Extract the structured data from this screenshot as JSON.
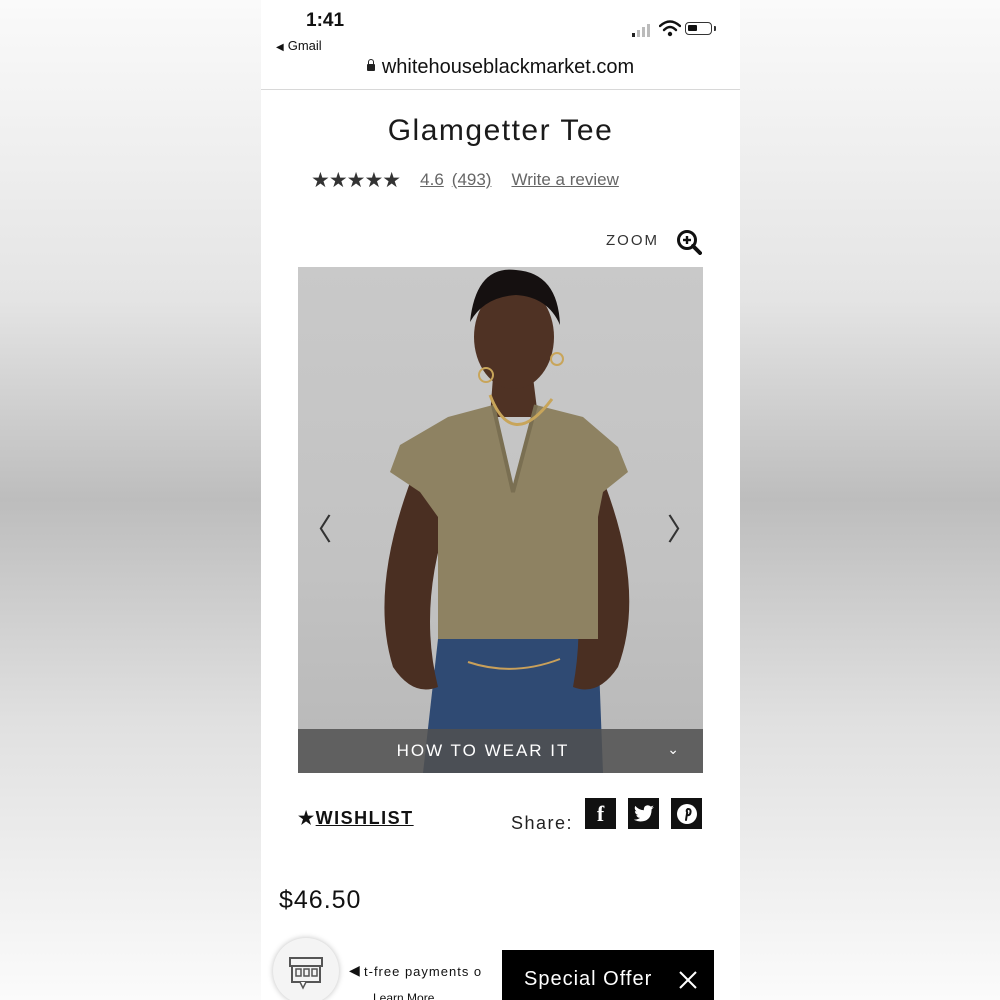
{
  "status_bar": {
    "time": "1:41",
    "back_app": "Gmail"
  },
  "browser": {
    "url": "whitehouseblackmarket.com"
  },
  "product": {
    "title": "Glamgetter Tee",
    "rating_stars": 4.6,
    "stars_glyphs": "★★★★★",
    "rating_value": "4.6",
    "review_count": "(493)",
    "write_review": "Write a review",
    "price": "$46.50"
  },
  "gallery": {
    "zoom_label": "ZOOM",
    "how_to_wear": "HOW TO WEAR IT",
    "prev_arrow": "〈",
    "next_arrow": "〉",
    "chevron": "⌄"
  },
  "actions": {
    "wishlist_star": "★",
    "wishlist_label": "WISHLIST",
    "share_label": "Share:",
    "social": [
      "f",
      "twitter",
      "pinterest"
    ]
  },
  "footer": {
    "promo_text": "t-free payments o",
    "learn_more": "Learn More",
    "special_offer": "Special Offer"
  },
  "icons": {
    "zoom": "zoom-in-icon",
    "store": "store-icon",
    "close": "close-icon",
    "lock": "lock-icon"
  }
}
